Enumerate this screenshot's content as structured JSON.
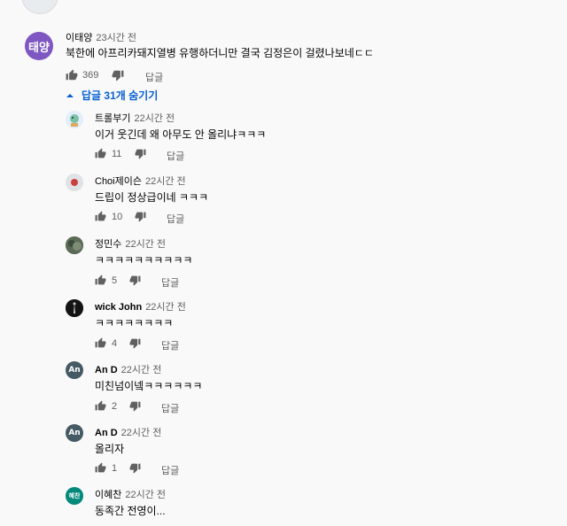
{
  "thread": {
    "author": "이태양",
    "time": "23시간 전",
    "avatar_initials": "태양",
    "text": "북한에 아프리카돼지열병 유행하더니만 결국 김정은이 걸렸나보네ㄷㄷ",
    "likes": "369",
    "reply_label": "답글"
  },
  "toggle_label": "답글 31개 숨기기",
  "replies": [
    {
      "author": "트롤부기",
      "time": "22시간 전",
      "text": "이거 웃긴데 왜 아무도 안 올리냐ㅋㅋㅋ",
      "likes": "11",
      "reply_label": "답글"
    },
    {
      "author": "Choi제이슨",
      "time": "22시간 전",
      "text": "드립이 정상급이네 ㅋㅋㅋ",
      "likes": "10",
      "reply_label": "답글"
    },
    {
      "author": "정민수",
      "time": "22시간 전",
      "text": "ㅋㅋㅋㅋㅋㅋㅋㅋㅋㅋ",
      "likes": "5",
      "reply_label": "답글"
    },
    {
      "author": "wick John",
      "time": "22시간 전",
      "text": "ㅋㅋㅋㅋㅋㅋㅋㅋ",
      "likes": "4",
      "reply_label": "답글"
    },
    {
      "author": "An D",
      "time": "22시간 전",
      "text": "미친넘이넼ㅋㅋㅋㅋㅋㅋ",
      "likes": "2",
      "reply_label": "답글",
      "avatar_initials": "An"
    },
    {
      "author": "An D",
      "time": "22시간 전",
      "text": "올리자",
      "likes": "1",
      "reply_label": "답글",
      "avatar_initials": "An"
    },
    {
      "author": "이혜찬",
      "time": "22시간 전",
      "text": "동족간 전영이...",
      "avatar_initials": "혜찬"
    }
  ],
  "colors": {
    "thread_avatar": "#7e57c2",
    "link_blue": "#065fd4",
    "an_avatar": "#455a64",
    "hyechan_avatar": "#00897b",
    "icon_gray": "#606060"
  }
}
